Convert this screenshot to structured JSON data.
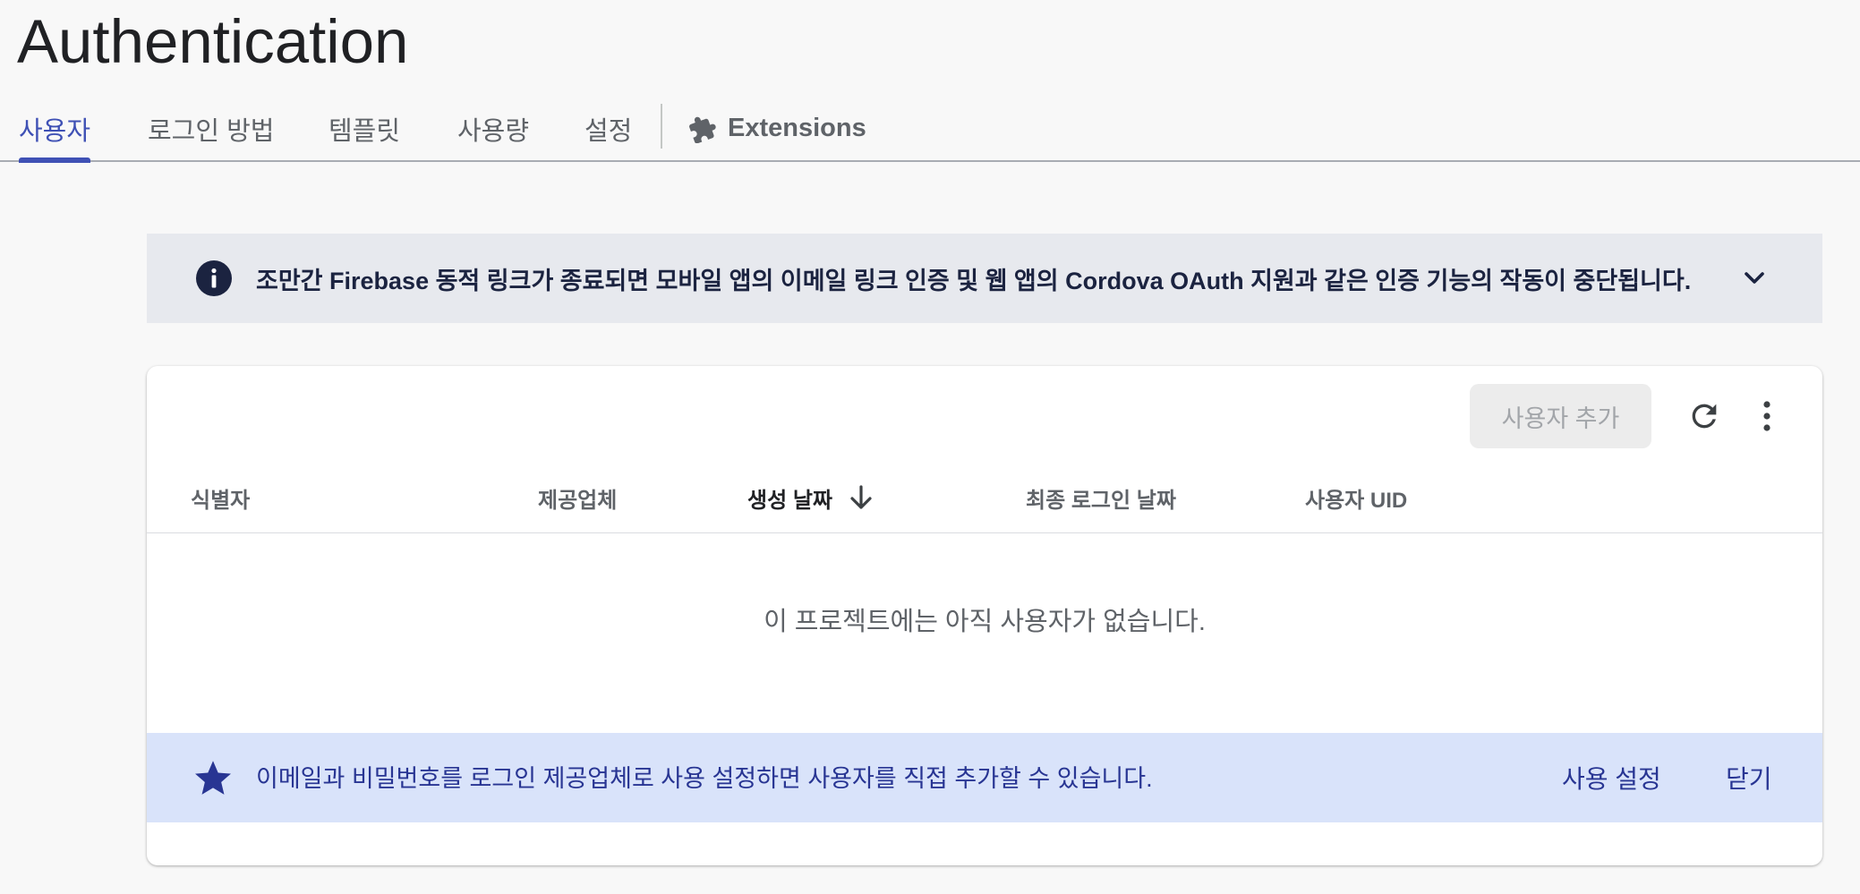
{
  "page": {
    "title": "Authentication"
  },
  "tabs": [
    {
      "label": "사용자",
      "active": true
    },
    {
      "label": "로그인 방법",
      "active": false
    },
    {
      "label": "템플릿",
      "active": false
    },
    {
      "label": "사용량",
      "active": false
    },
    {
      "label": "설정",
      "active": false
    },
    {
      "label": "Extensions",
      "active": false,
      "icon": "puzzle-icon"
    }
  ],
  "banner": {
    "icon": "info-icon",
    "text": "조만간 Firebase 동적 링크가 종료되면 모바일 앱의 이메일 링크 인증 및 웹 앱의 Cordova OAuth 지원과 같은 인증 기능의 작동이 중단됩니다.",
    "expand_icon": "chevron-down-icon"
  },
  "toolbar": {
    "add_user_label": "사용자 추가",
    "add_user_enabled": false,
    "refresh_icon": "refresh-icon",
    "more_icon": "more-vert-icon"
  },
  "table": {
    "columns": [
      {
        "label": "식별자"
      },
      {
        "label": "제공업체"
      },
      {
        "label": "생성 날짜",
        "sorted": "descending"
      },
      {
        "label": "최종 로그인 날짜"
      },
      {
        "label": "사용자 UID"
      }
    ],
    "empty_message": "이 프로젝트에는 아직 사용자가 없습니다."
  },
  "promo": {
    "icon": "star-icon",
    "text": "이메일과 비밀번호를 로그인 제공업체로 사용 설정하면 사용자를 직접 추가할 수 있습니다.",
    "enable_label": "사용 설정",
    "close_label": "닫기"
  },
  "colors": {
    "accent": "#3f51b5",
    "banner_bg": "#e7e9ee",
    "promo_bg": "#d9e3fa",
    "promo_text": "#283593",
    "info_icon": "#1b2340"
  }
}
